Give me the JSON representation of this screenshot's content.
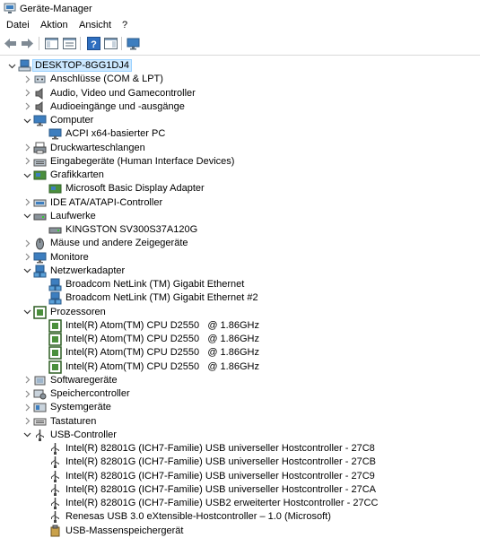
{
  "window": {
    "title": "Geräte-Manager"
  },
  "menu": [
    "Datei",
    "Aktion",
    "Ansicht",
    "?"
  ],
  "toolbar": [
    {
      "name": "back-button",
      "icon": "arrow-left-icon"
    },
    {
      "name": "forward-button",
      "icon": "arrow-right-icon"
    },
    {
      "name": "show-hide-console-tree-button",
      "icon": "console-tree-icon"
    },
    {
      "name": "properties-button",
      "icon": "properties-icon"
    },
    {
      "name": "help-button",
      "icon": "help-icon"
    },
    {
      "name": "action-pane-button",
      "icon": "action-pane-icon"
    },
    {
      "name": "monitor-button",
      "icon": "monitor-icon"
    }
  ],
  "tree": [
    {
      "label": "DESKTOP-8GG1DJ4",
      "level": 0,
      "expander": "open",
      "icon": "computer-icon",
      "selected": true
    },
    {
      "label": "Anschlüsse (COM & LPT)",
      "level": 1,
      "expander": "closed",
      "icon": "port-icon"
    },
    {
      "label": "Audio, Video und Gamecontroller",
      "level": 1,
      "expander": "closed",
      "icon": "speaker-icon"
    },
    {
      "label": "Audioeingänge und -ausgänge",
      "level": 1,
      "expander": "closed",
      "icon": "speaker-icon"
    },
    {
      "label": "Computer",
      "level": 1,
      "expander": "open",
      "icon": "monitor-icon"
    },
    {
      "label": "ACPI x64-basierter PC",
      "level": 2,
      "expander": "none",
      "icon": "monitor-icon"
    },
    {
      "label": "Druckwarteschlangen",
      "level": 1,
      "expander": "closed",
      "icon": "printer-icon"
    },
    {
      "label": "Eingabegeräte (Human Interface Devices)",
      "level": 1,
      "expander": "closed",
      "icon": "hid-icon"
    },
    {
      "label": "Grafikkarten",
      "level": 1,
      "expander": "open",
      "icon": "display-adapter-icon"
    },
    {
      "label": "Microsoft Basic Display Adapter",
      "level": 2,
      "expander": "none",
      "icon": "display-adapter-icon"
    },
    {
      "label": "IDE ATA/ATAPI-Controller",
      "level": 1,
      "expander": "closed",
      "icon": "ide-controller-icon"
    },
    {
      "label": "Laufwerke",
      "level": 1,
      "expander": "open",
      "icon": "drive-icon"
    },
    {
      "label": "KINGSTON SV300S37A120G",
      "level": 2,
      "expander": "none",
      "icon": "drive-icon"
    },
    {
      "label": "Mäuse und andere Zeigegeräte",
      "level": 1,
      "expander": "closed",
      "icon": "mouse-icon"
    },
    {
      "label": "Monitore",
      "level": 1,
      "expander": "closed",
      "icon": "monitor-icon"
    },
    {
      "label": "Netzwerkadapter",
      "level": 1,
      "expander": "open",
      "icon": "network-icon"
    },
    {
      "label": "Broadcom NetLink (TM) Gigabit Ethernet",
      "level": 2,
      "expander": "none",
      "icon": "network-icon"
    },
    {
      "label": "Broadcom NetLink (TM) Gigabit Ethernet #2",
      "level": 2,
      "expander": "none",
      "icon": "network-icon"
    },
    {
      "label": "Prozessoren",
      "level": 1,
      "expander": "open",
      "icon": "processor-icon"
    },
    {
      "label": "Intel(R) Atom(TM) CPU D2550   @ 1.86GHz",
      "level": 2,
      "expander": "none",
      "icon": "processor-icon"
    },
    {
      "label": "Intel(R) Atom(TM) CPU D2550   @ 1.86GHz",
      "level": 2,
      "expander": "none",
      "icon": "processor-icon"
    },
    {
      "label": "Intel(R) Atom(TM) CPU D2550   @ 1.86GHz",
      "level": 2,
      "expander": "none",
      "icon": "processor-icon"
    },
    {
      "label": "Intel(R) Atom(TM) CPU D2550   @ 1.86GHz",
      "level": 2,
      "expander": "none",
      "icon": "processor-icon"
    },
    {
      "label": "Softwaregeräte",
      "level": 1,
      "expander": "closed",
      "icon": "software-device-icon"
    },
    {
      "label": "Speichercontroller",
      "level": 1,
      "expander": "closed",
      "icon": "storage-controller-icon"
    },
    {
      "label": "Systemgeräte",
      "level": 1,
      "expander": "closed",
      "icon": "system-device-icon"
    },
    {
      "label": "Tastaturen",
      "level": 1,
      "expander": "closed",
      "icon": "keyboard-icon"
    },
    {
      "label": "USB-Controller",
      "level": 1,
      "expander": "open",
      "icon": "usb-icon"
    },
    {
      "label": "Intel(R) 82801G (ICH7-Familie) USB universeller Hostcontroller - 27C8",
      "level": 2,
      "expander": "none",
      "icon": "usb-icon"
    },
    {
      "label": "Intel(R) 82801G (ICH7-Familie) USB universeller Hostcontroller - 27CB",
      "level": 2,
      "expander": "none",
      "icon": "usb-icon"
    },
    {
      "label": "Intel(R) 82801G (ICH7-Familie) USB universeller Hostcontroller - 27C9",
      "level": 2,
      "expander": "none",
      "icon": "usb-icon"
    },
    {
      "label": "Intel(R) 82801G (ICH7-Familie) USB universeller Hostcontroller - 27CA",
      "level": 2,
      "expander": "none",
      "icon": "usb-icon"
    },
    {
      "label": "Intel(R) 82801G (ICH7-Familie) USB2 erweiterter Hostcontroller - 27CC",
      "level": 2,
      "expander": "none",
      "icon": "usb-icon"
    },
    {
      "label": "Renesas USB 3.0 eXtensible-Hostcontroller – 1.0 (Microsoft)",
      "level": 2,
      "expander": "none",
      "icon": "usb-icon"
    },
    {
      "label": "USB-Massenspeichergerät",
      "level": 2,
      "expander": "none",
      "icon": "usb-storage-icon"
    }
  ]
}
